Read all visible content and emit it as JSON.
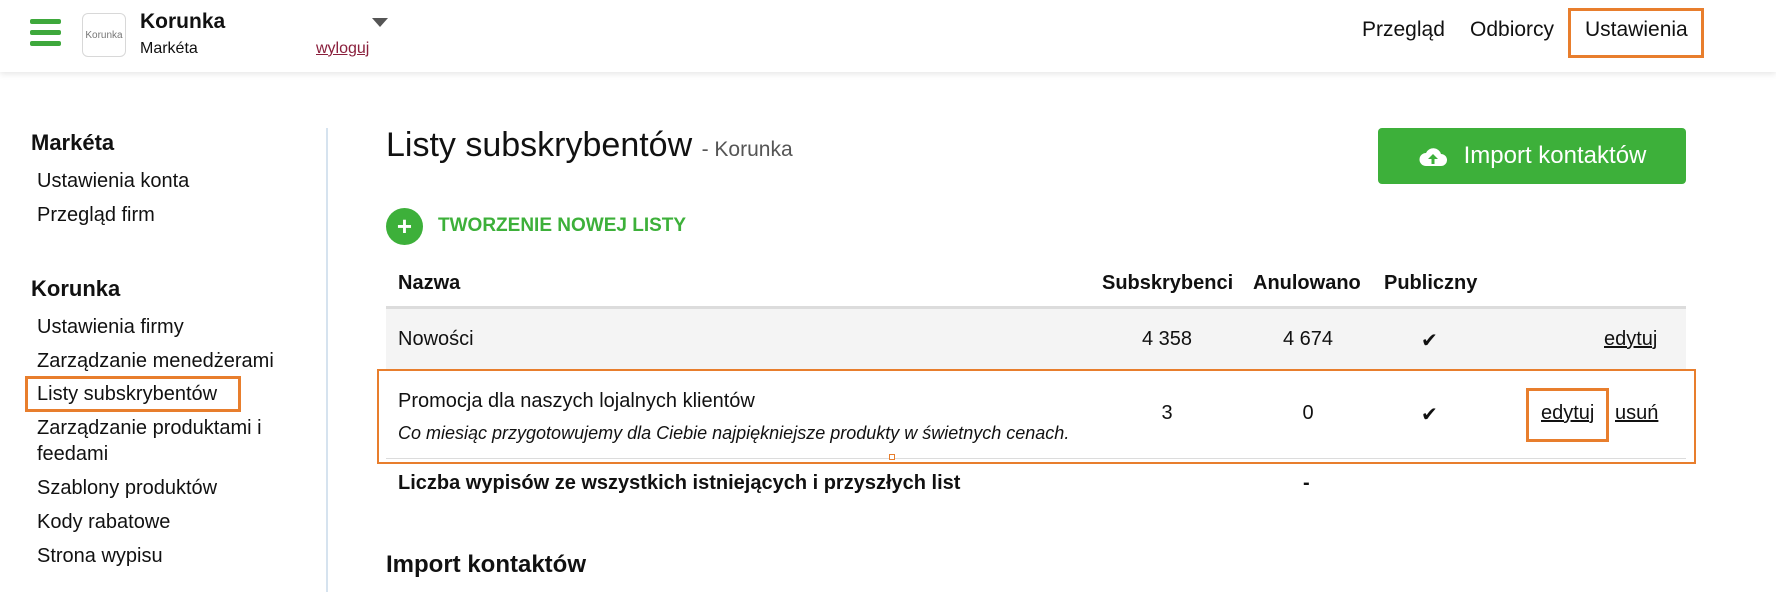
{
  "header": {
    "logo_text": "Korunka",
    "company_name": "Korunka",
    "user_name": "Markéta",
    "logout_label": "wyloguj",
    "nav": {
      "overview": "Przegląd",
      "recipients": "Odbiorcy",
      "settings": "Ustawienia"
    }
  },
  "sidebar": {
    "user_section": {
      "heading": "Markéta",
      "items": [
        "Ustawienia konta",
        "Przegląd firm"
      ]
    },
    "company_section": {
      "heading": "Korunka",
      "items": [
        "Ustawienia firmy",
        "Zarządzanie menedżerami",
        "Listy subskrybentów",
        "Zarządzanie produktami i",
        "feedami",
        "Szablony produktów",
        "Kody rabatowe",
        "Strona wypisu"
      ]
    }
  },
  "main": {
    "title": "Listy subskrybentów",
    "subtitle": "- Korunka",
    "import_button": "Import kontaktów",
    "new_list_label": "TWORZENIE NOWEJ LISTY",
    "table": {
      "headers": {
        "name": "Nazwa",
        "subscribers": "Subskrybenci",
        "cancelled": "Anulowano",
        "public": "Publiczny"
      },
      "rows": [
        {
          "name": "Nowości",
          "subscribers": "4 358",
          "cancelled": "4 674",
          "public_mark": "✔",
          "edit_label": "edytuj"
        },
        {
          "name": "Promocja dla naszych lojalnych klientów",
          "description": "Co miesiąc przygotowujemy dla Ciebie najpiękniejsze produkty w świetnych cenach.",
          "subscribers": "3",
          "cancelled": "0",
          "public_mark": "✔",
          "edit_label": "edytuj",
          "delete_label": "usuń"
        }
      ],
      "total_label": "Liczba wypisów ze wszystkich istniejących i przyszłych list",
      "total_value": "-"
    },
    "import_section_heading": "Import kontaktów"
  },
  "colors": {
    "accent_green": "#3db03a",
    "highlight_orange": "#e87e2d",
    "logout_link": "#8a1f3c"
  }
}
